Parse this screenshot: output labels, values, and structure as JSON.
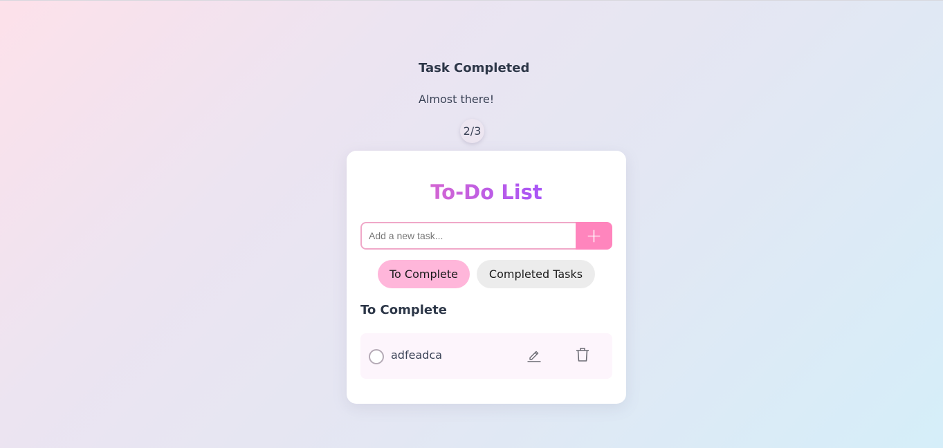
{
  "status": {
    "title": "Task Completed",
    "message": "Almost there!",
    "counter": "2/3"
  },
  "card": {
    "title": "To-Do List",
    "input": {
      "placeholder": "Add a new task...",
      "value": ""
    },
    "add_button_label": "+",
    "tabs": [
      {
        "label": "To Complete",
        "active": true
      },
      {
        "label": "Completed Tasks",
        "active": false
      }
    ],
    "section_heading": "To Complete",
    "tasks": [
      {
        "text": "adfeadca",
        "completed": false
      }
    ]
  },
  "icons": {
    "edit": "pencil-icon",
    "delete": "trash-icon"
  },
  "colors": {
    "accent_pink": "#ff85bd",
    "active_tab": "#ffb6da",
    "title_gradient_start": "#f472b6",
    "title_gradient_end": "#8b7cf0"
  }
}
